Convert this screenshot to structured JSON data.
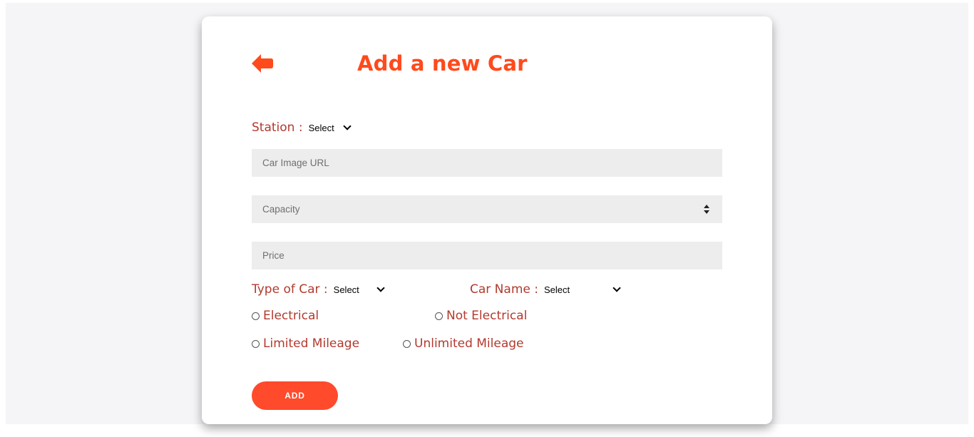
{
  "header": {
    "title": "Add a new Car",
    "back_icon": "arrow-left-icon",
    "accent_color": "#ff4a1c"
  },
  "form": {
    "station": {
      "label": "Station :",
      "selected": "Select"
    },
    "image_url": {
      "placeholder": "Car Image URL"
    },
    "capacity": {
      "placeholder": "Capacity"
    },
    "price": {
      "placeholder": "Price"
    },
    "type_of_car": {
      "label": "Type of Car :",
      "selected": "Select"
    },
    "car_name": {
      "label": "Car Name :",
      "selected": "Select"
    },
    "power_options": [
      "Electrical",
      "Not Electrical"
    ],
    "mileage_options": [
      "Limited Mileage",
      "Unlimited Mileage"
    ],
    "submit_label": "ADD"
  },
  "colors": {
    "label": "#b23a2e",
    "button": "#ff4a2c",
    "field_bg": "#ededed"
  }
}
